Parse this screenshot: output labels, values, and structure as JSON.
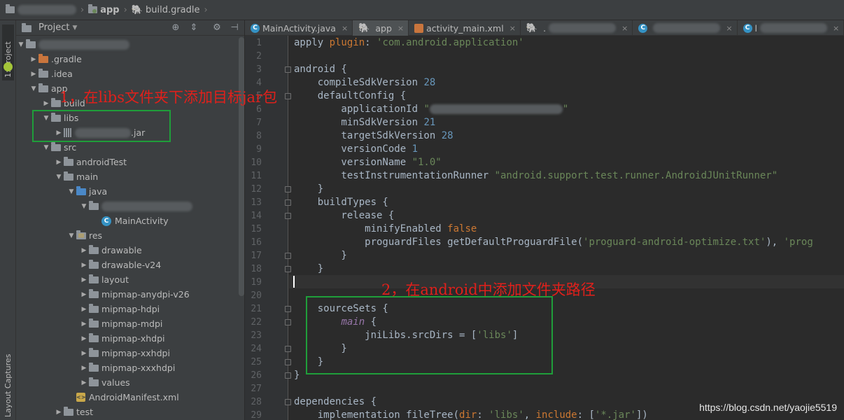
{
  "breadcrumb": {
    "module": "app",
    "file": "build.gradle"
  },
  "tool_strip": {
    "project_tab": "1: Project",
    "captures_tab": "Layout Captures"
  },
  "project_panel": {
    "title": "Project",
    "tree": [
      {
        "label": "",
        "icon": "folder-icon",
        "color": "gray",
        "arrow": "down",
        "blurred": true
      },
      {
        "label": ".gradle",
        "icon": "folder-icon",
        "color": "orange",
        "arrow": "right"
      },
      {
        "label": ".idea",
        "icon": "folder-icon",
        "color": "gray",
        "arrow": "right"
      },
      {
        "label": "app",
        "icon": "folder-icon",
        "color": "gray",
        "arrow": "down"
      },
      {
        "label": "build",
        "icon": "folder-icon",
        "color": "gray",
        "arrow": "right"
      },
      {
        "label": "libs",
        "icon": "folder-icon",
        "color": "gray",
        "arrow": "down"
      },
      {
        "label": ".jar",
        "icon": "jar-icon",
        "arrow": "right",
        "blurred": true
      },
      {
        "label": "src",
        "icon": "folder-icon",
        "color": "gray",
        "arrow": "down"
      },
      {
        "label": "androidTest",
        "icon": "folder-icon",
        "color": "gray",
        "arrow": "right"
      },
      {
        "label": "main",
        "icon": "folder-icon",
        "color": "gray",
        "arrow": "down"
      },
      {
        "label": "java",
        "icon": "folder-icon",
        "color": "blue",
        "arrow": "down"
      },
      {
        "label": "",
        "icon": "folder-icon",
        "color": "gray",
        "arrow": "down",
        "blurred": true
      },
      {
        "label": "MainActivity",
        "icon": "class-icon",
        "arrow": "none"
      },
      {
        "label": "res",
        "icon": "res-folder-icon",
        "color": "res",
        "arrow": "down"
      },
      {
        "label": "drawable",
        "icon": "folder-icon",
        "color": "gray",
        "arrow": "right"
      },
      {
        "label": "drawable-v24",
        "icon": "folder-icon",
        "color": "gray",
        "arrow": "right"
      },
      {
        "label": "layout",
        "icon": "folder-icon",
        "color": "gray",
        "arrow": "right"
      },
      {
        "label": "mipmap-anydpi-v26",
        "icon": "folder-icon",
        "color": "gray",
        "arrow": "right"
      },
      {
        "label": "mipmap-hdpi",
        "icon": "folder-icon",
        "color": "gray",
        "arrow": "right"
      },
      {
        "label": "mipmap-mdpi",
        "icon": "folder-icon",
        "color": "gray",
        "arrow": "right"
      },
      {
        "label": "mipmap-xhdpi",
        "icon": "folder-icon",
        "color": "gray",
        "arrow": "right"
      },
      {
        "label": "mipmap-xxhdpi",
        "icon": "folder-icon",
        "color": "gray",
        "arrow": "right"
      },
      {
        "label": "mipmap-xxxhdpi",
        "icon": "folder-icon",
        "color": "gray",
        "arrow": "right"
      },
      {
        "label": "values",
        "icon": "folder-icon",
        "color": "gray",
        "arrow": "right"
      },
      {
        "label": "AndroidManifest.xml",
        "icon": "xml-icon",
        "arrow": "none"
      },
      {
        "label": "test",
        "icon": "folder-icon",
        "color": "gray",
        "arrow": "right"
      }
    ]
  },
  "editor_tabs": [
    {
      "label": "MainActivity.java",
      "icon": "class-icon",
      "active": false
    },
    {
      "label": "app",
      "icon": "gradle-icon",
      "active": true
    },
    {
      "label": "activity_main.xml",
      "icon": "xml-icon",
      "active": false
    },
    {
      "label": ".",
      "icon": "gradle-icon",
      "active": false,
      "blurred": true
    },
    {
      "label": "",
      "icon": "class-icon",
      "active": false,
      "blurred": true
    },
    {
      "label": "l",
      "icon": "class-icon",
      "active": false,
      "blurred": true
    }
  ],
  "editor": {
    "start_line": 1,
    "lines": [
      [
        [
          "apply ",
          ""
        ],
        [
          "plugin",
          "kw"
        ],
        [
          ": ",
          ""
        ],
        [
          "'com.android.application'",
          "str"
        ]
      ],
      [],
      [
        [
          "android {",
          ""
        ]
      ],
      [
        [
          "    compileSdkVersion ",
          ""
        ],
        [
          "28",
          "num"
        ]
      ],
      [
        [
          "    defaultConfig {",
          ""
        ]
      ],
      [
        [
          "        applicationId ",
          ""
        ],
        [
          "\"",
          "str"
        ],
        [
          "                       ",
          "blur"
        ],
        [
          "\"",
          "str"
        ]
      ],
      [
        [
          "        minSdkVersion ",
          ""
        ],
        [
          "21",
          "num"
        ]
      ],
      [
        [
          "        targetSdkVersion ",
          ""
        ],
        [
          "28",
          "num"
        ]
      ],
      [
        [
          "        versionCode ",
          ""
        ],
        [
          "1",
          "num"
        ]
      ],
      [
        [
          "        versionName ",
          ""
        ],
        [
          "\"1.0\"",
          "str"
        ]
      ],
      [
        [
          "        testInstrumentationRunner ",
          ""
        ],
        [
          "\"android.support.test.runner.AndroidJUnitRunner\"",
          "str"
        ]
      ],
      [
        [
          "    }",
          ""
        ]
      ],
      [
        [
          "    buildTypes {",
          ""
        ]
      ],
      [
        [
          "        release {",
          ""
        ]
      ],
      [
        [
          "            minifyEnabled ",
          ""
        ],
        [
          "false",
          "kw"
        ]
      ],
      [
        [
          "            proguardFiles getDefaultProguardFile(",
          ""
        ],
        [
          "'proguard-android-optimize.txt'",
          "str"
        ],
        [
          "), ",
          ""
        ],
        [
          "'prog",
          "str"
        ]
      ],
      [
        [
          "        }",
          ""
        ]
      ],
      [
        [
          "    }",
          ""
        ]
      ],
      [],
      [],
      [
        [
          "    sourceSets {",
          ""
        ]
      ],
      [
        [
          "        ",
          ""
        ],
        [
          "main",
          "ital"
        ],
        [
          " {",
          ""
        ]
      ],
      [
        [
          "            jniLibs.srcDirs = [",
          ""
        ],
        [
          "'libs'",
          "str"
        ],
        [
          "]",
          ""
        ]
      ],
      [
        [
          "        }",
          ""
        ]
      ],
      [
        [
          "    }",
          ""
        ]
      ],
      [
        [
          "}",
          ""
        ]
      ],
      [],
      [
        [
          "dependencies {",
          ""
        ]
      ],
      [
        [
          "    implementation fileTree(",
          ""
        ],
        [
          "dir",
          "kw"
        ],
        [
          ": ",
          ""
        ],
        [
          "'libs'",
          "str"
        ],
        [
          ", ",
          ""
        ],
        [
          "include",
          "kw"
        ],
        [
          ": [",
          ""
        ],
        [
          "'*.jar'",
          "str"
        ],
        [
          "])",
          ""
        ]
      ]
    ]
  },
  "annotations": {
    "step1": "1，在libs文件夹下添加目标jar包",
    "step2": "2，在android中添加文件夹路径"
  },
  "watermark": "https://blog.csdn.net/yaojie5519",
  "colors": {
    "annotation_text": "#e0201b",
    "annotation_box": "#1f9e3a"
  }
}
